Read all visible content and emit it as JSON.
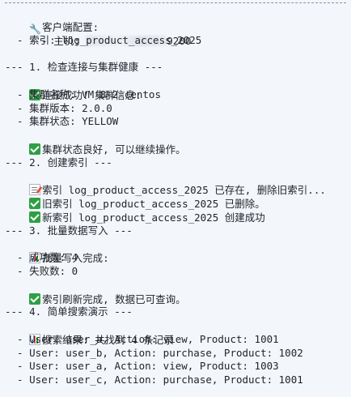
{
  "client_config": {
    "title": "客户端配置:",
    "host_label": "  - 主机: ",
    "host_suffix": "9200",
    "index_line": "  - 索引: log_product_access_2025"
  },
  "step1": {
    "header": "--- 1. 检查连接与集群健康 ---",
    "connected": "连接成功! 集群信息:",
    "cluster_name": "  - 集群名称: VM-8-2-centos",
    "cluster_version": "  - 集群版本: 2.0.0",
    "cluster_status": "  - 集群状态: YELLOW",
    "status_ok": "集群状态良好, 可以继续操作。"
  },
  "step2": {
    "header": "--- 2. 创建索引 ---",
    "exists": "索引 log_product_access_2025 已存在, 删除旧索引...",
    "deleted": "旧索引 log_product_access_2025 已删除。",
    "created": "新索引 log_product_access_2025 创建成功"
  },
  "step3": {
    "header": "--- 3. 批量数据写入 ---",
    "done": "批量写入完成:",
    "success": "  - 成功数: 4",
    "failed": "  - 失败数: 0",
    "refreshed": "索引刷新完成, 数据已可查询。"
  },
  "step4": {
    "header": "--- 4. 简单搜索演示 ---",
    "result": "搜索结果: 共找到 4 条记录",
    "records": [
      "  - User: user_a, Action: view, Product: 1001",
      "  - User: user_b, Action: purchase, Product: 1002",
      "  - User: user_a, Action: view, Product: 1003",
      "  - User: user_c, Action: purchase, Product: 1001"
    ]
  },
  "colors": {
    "success": "#2ea043",
    "background": "#f3f6fb",
    "text": "#1f2328"
  },
  "icons": [
    "wrench-icon",
    "check-icon",
    "memo-icon",
    "bar-chart-icon"
  ]
}
